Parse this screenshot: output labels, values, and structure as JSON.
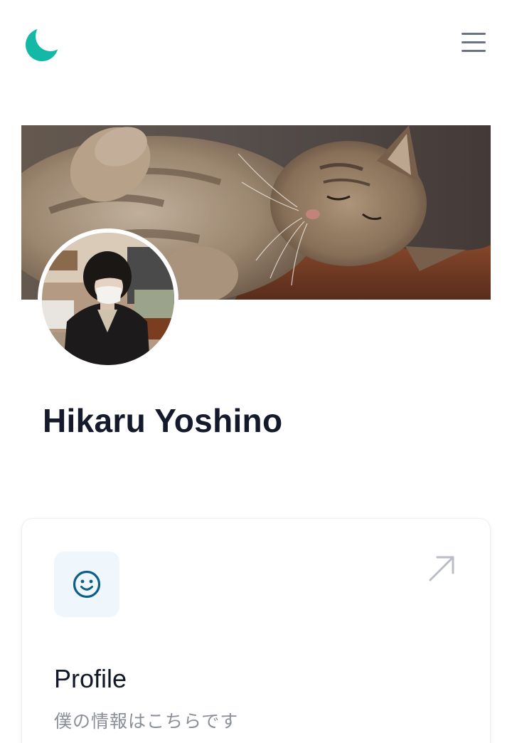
{
  "header": {
    "logo_icon": "crescent-moon-icon",
    "logo_color": "#14b8a6",
    "menu_icon": "hamburger-menu-icon"
  },
  "profile": {
    "name": "Hikaru Yoshino",
    "cover_image": "sleeping-tabby-cat-photo",
    "avatar_image": "person-in-black-coat-and-mask-photo"
  },
  "card": {
    "icon": "smiley-face-icon",
    "icon_color": "#0b5f8a",
    "arrow_icon": "arrow-up-right-icon",
    "title": "Profile",
    "description": "僕の情報はこちらです"
  }
}
